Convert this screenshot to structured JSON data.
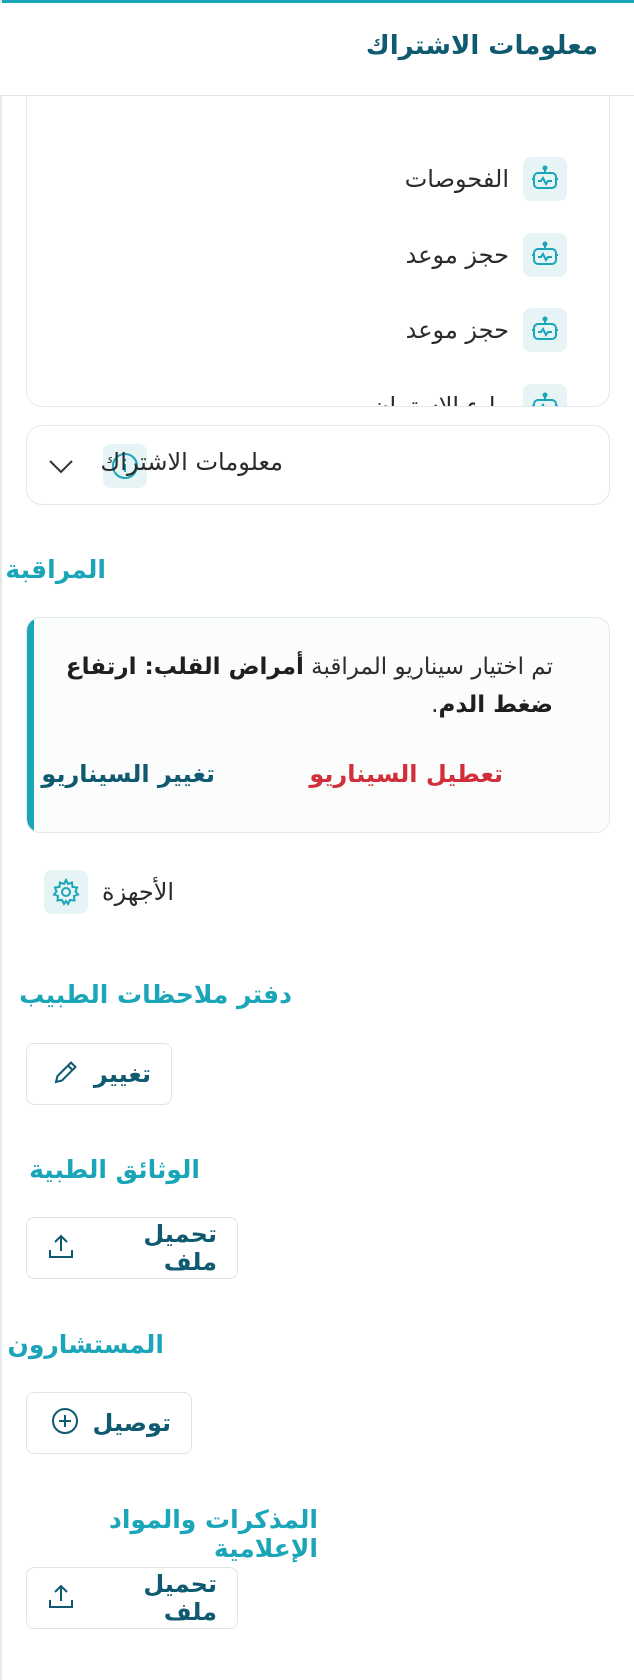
{
  "header": {
    "title": "معلومات الاشتراك"
  },
  "list": {
    "items": [
      {
        "label": "الفحوصات",
        "icon": "bot-icon"
      },
      {
        "label": "حجز موعد",
        "icon": "bot-icon"
      },
      {
        "label": "حجز موعد",
        "icon": "bot-icon"
      },
      {
        "label": "ملء الاستبيان",
        "icon": "bot-icon"
      }
    ]
  },
  "subscription": {
    "label": "معلومات الاشتراك",
    "icon": "info-icon",
    "chevron_icon": "chevron-down-icon"
  },
  "monitoring": {
    "heading": "المراقبة",
    "text_prefix": "تم اختيار سيناريو المراقبة ",
    "text_bold": "أمراض القلب: ارتفاع ضغط الدم",
    "text_suffix": ".",
    "disable_label": "تعطيل السيناريو",
    "change_label": "تغيير السيناريو"
  },
  "devices": {
    "label": "الأجهزة",
    "icon": "gear-icon"
  },
  "doctor_notes": {
    "heading": "دفتر ملاحظات الطبيب",
    "button_label": "تغيير",
    "icon": "pencil-icon"
  },
  "medical_docs": {
    "heading": "الوثائق الطبية",
    "button_label": "تحميل ملف",
    "icon": "upload-icon"
  },
  "consultants": {
    "heading": "المستشارون",
    "button_label": "توصيل",
    "icon": "plus-circle-icon"
  },
  "memos": {
    "heading": "المذكرات والمواد الإعلامية",
    "button_label": "تحميل ملف",
    "icon": "upload-icon"
  },
  "colors": {
    "accent": "#1ba5b8",
    "primary_dark": "#0f5a70",
    "danger": "#d32f3a"
  }
}
